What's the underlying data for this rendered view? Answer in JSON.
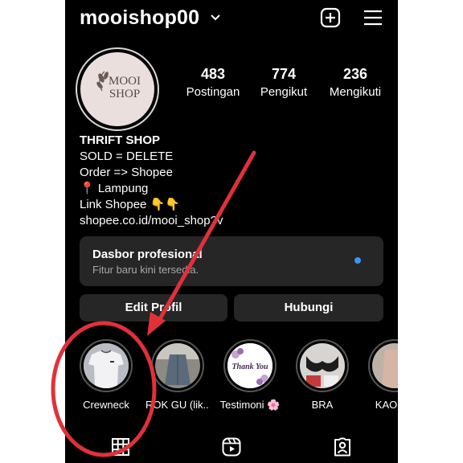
{
  "header": {
    "username": "mooishop00",
    "icons": [
      "chevron-down-icon",
      "plus-square-icon",
      "menu-icon"
    ]
  },
  "profile": {
    "avatar_text_line1": "MOOI",
    "avatar_text_line2": "SHOP",
    "stats": [
      {
        "value": "483",
        "label": "Postingan"
      },
      {
        "value": "774",
        "label": "Pengikut"
      },
      {
        "value": "236",
        "label": "Mengikuti"
      }
    ]
  },
  "bio": {
    "name": "THRIFT SHOP",
    "line1": "SOLD = DELETE",
    "line2": "Order => Shopee",
    "line3": "📍 Lampung",
    "line4": "Link Shopee 👇👇",
    "link": "shopee.co.id/mooi_shop?v"
  },
  "dashboard": {
    "title": "Dasbor profesional",
    "subtitle": "Fitur baru kini tersedia.",
    "dot_color": "#3897f0"
  },
  "buttons": {
    "edit": "Edit Profil",
    "contact": "Hubungi"
  },
  "highlights": [
    {
      "label": "Crewneck"
    },
    {
      "label": "ROK GU (lik..."
    },
    {
      "label": "Testimoni 🌸",
      "thumb_text": "Thank You"
    },
    {
      "label": "BRA"
    },
    {
      "label": "KAOS P"
    }
  ],
  "tabs": [
    "grid-icon",
    "reels-icon",
    "tagged-icon"
  ],
  "annotation": {
    "color": "#e0313a"
  }
}
